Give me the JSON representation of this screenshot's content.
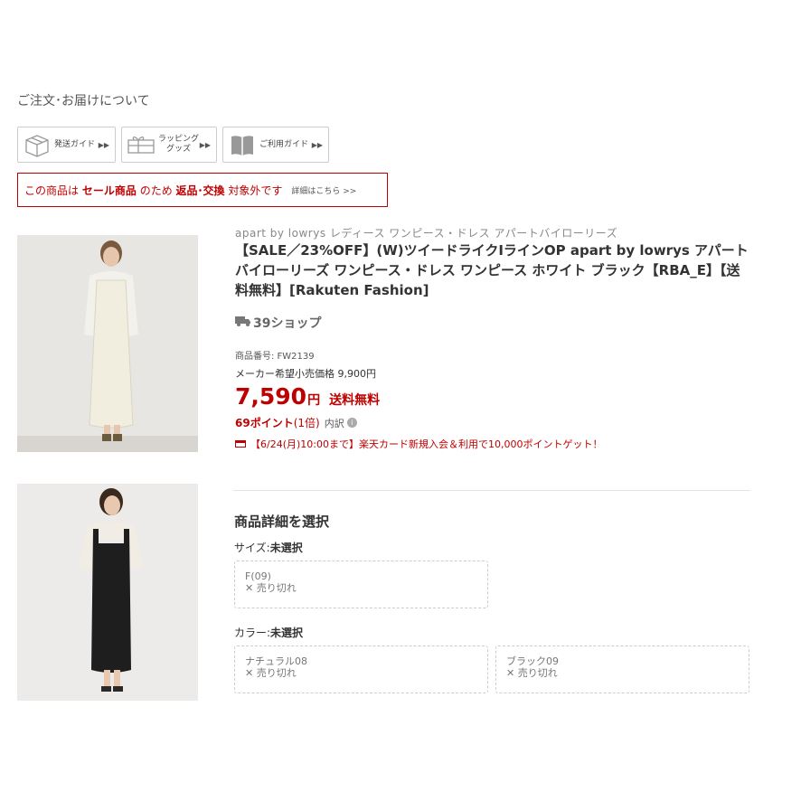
{
  "section_title": "ご注文･お届けについて",
  "guides": [
    {
      "label": "発送ガイド",
      "icon": "box-icon"
    },
    {
      "label": "ラッピング\nグッズ",
      "icon": "gift-ribbon-icon"
    },
    {
      "label": "ご利用ガイド",
      "icon": "book-icon"
    }
  ],
  "guide_arrow": "▶▶",
  "notice": {
    "prefix": "この商品は",
    "sale_item": "セール商品",
    "middle": "のため",
    "return_exchange": "返品･交換",
    "suffix": "対象外です",
    "detail_link": "詳細はこちら >>"
  },
  "product": {
    "brand_line": "apart by lowrys レディース ワンピース・ドレス アパートバイローリーズ",
    "title": "【SALE／23%OFF】(W)ツイードライクIラインOP apart by lowrys アパートバイローリーズ ワンピース・ドレス ワンピース ホワイト ブラック【RBA_E】【送料無料】[Rakuten Fashion]",
    "shipping_badge": "39ショップ",
    "item_number": "商品番号: FW2139",
    "msrp": "メーカー希望小売価格 9,900円",
    "price": "7,590",
    "price_unit": "円",
    "shipping_free": "送料無料",
    "points": "69ポイント",
    "points_rate": "(1倍)",
    "points_breakdown": "内訳",
    "campaign": "【6/24(月)10:00まで】楽天カード新規入会＆利用で10,000ポイントゲット！"
  },
  "selection": {
    "title": "商品詳細を選択",
    "size": {
      "label": "サイズ:",
      "status": "未選択",
      "options": [
        {
          "name": "F(09)",
          "stock": "✕ 売り切れ"
        }
      ]
    },
    "color": {
      "label": "カラー:",
      "status": "未選択",
      "options": [
        {
          "name": "ナチュラル08",
          "stock": "✕ 売り切れ"
        },
        {
          "name": "ブラック09",
          "stock": "✕ 売り切れ"
        }
      ]
    }
  },
  "colors": {
    "accent_red": "#bf0000",
    "border_gray": "#cccccc",
    "text": "#333333"
  }
}
